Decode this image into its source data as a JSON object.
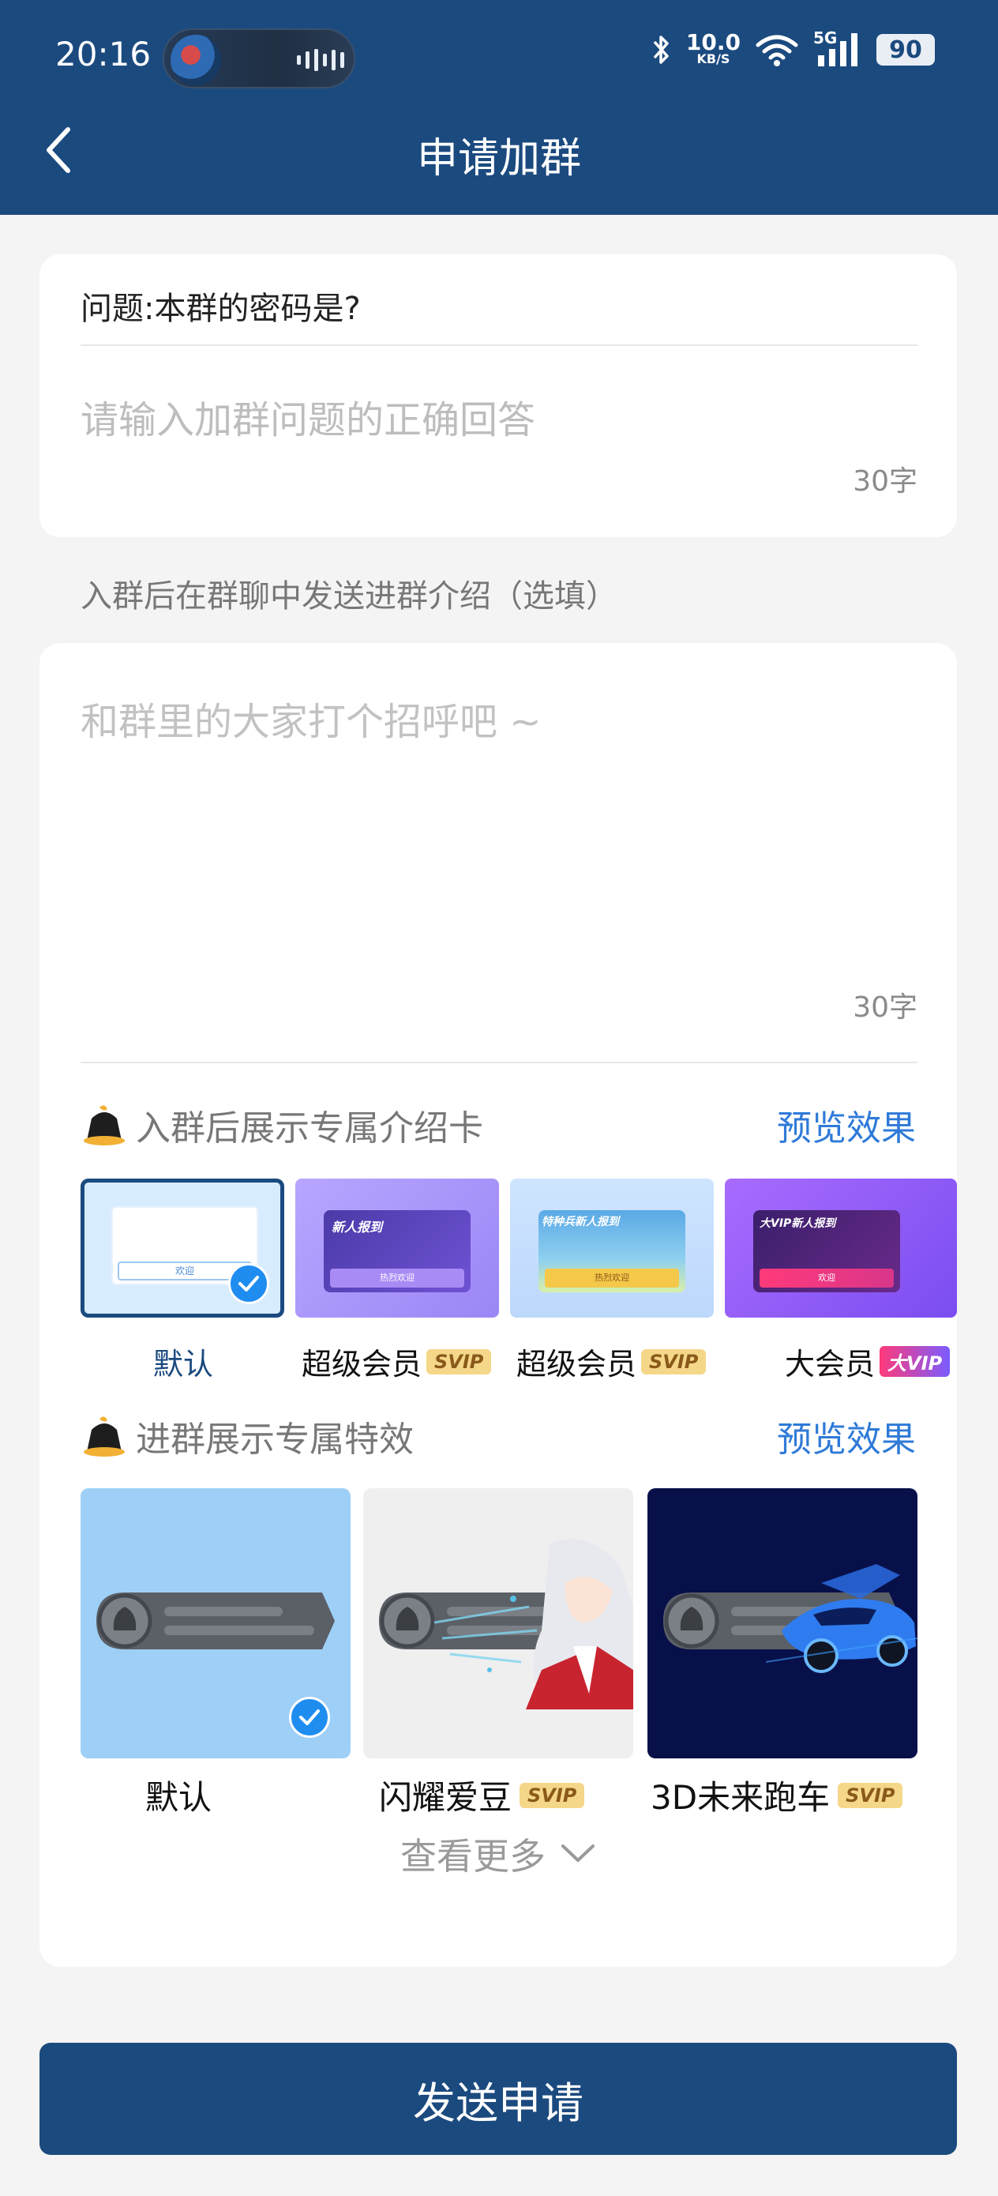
{
  "status_bar": {
    "time": "20:16",
    "net_speed": "10.0",
    "net_unit": "KB/S",
    "network": "5G",
    "battery": "90"
  },
  "header": {
    "title": "申请加群"
  },
  "question_card": {
    "question": "问题:本群的密码是?",
    "answer_placeholder": "请输入加群问题的正确回答",
    "counter": "30字"
  },
  "intro_hint": "入群后在群聊中发送进群介绍（选填）",
  "intro_card": {
    "placeholder": "和群里的大家打个招呼吧 ~",
    "counter": "30字",
    "card_section": {
      "title": "入群后展示专属介绍卡",
      "preview_label": "预览效果",
      "items": [
        {
          "label": "默认",
          "tag": "",
          "selected": true
        },
        {
          "label": "超级会员",
          "tag": "SVIP",
          "selected": false
        },
        {
          "label": "超级会员",
          "tag": "SVIP",
          "selected": false
        },
        {
          "label": "大会员",
          "tag": "大VIP",
          "selected": false
        }
      ],
      "card_texts": [
        "新人报到",
        "热烈欢迎",
        "特种兵新人报到",
        "热烈欢迎",
        "大VIP新人报到",
        "欢迎",
        "欢迎"
      ]
    },
    "effect_section": {
      "title": "进群展示专属特效",
      "preview_label": "预览效果",
      "items": [
        {
          "label": "默认",
          "tag": "",
          "selected": true
        },
        {
          "label": "闪耀爱豆",
          "tag": "SVIP",
          "selected": false
        },
        {
          "label": "3D未来跑车",
          "tag": "SVIP",
          "selected": false
        }
      ]
    },
    "more_label": "查看更多"
  },
  "submit_label": "发送申请",
  "colors": {
    "header_bg": "#1b4a7f",
    "accent_link": "#2f7ad8",
    "check": "#1f8df0"
  }
}
